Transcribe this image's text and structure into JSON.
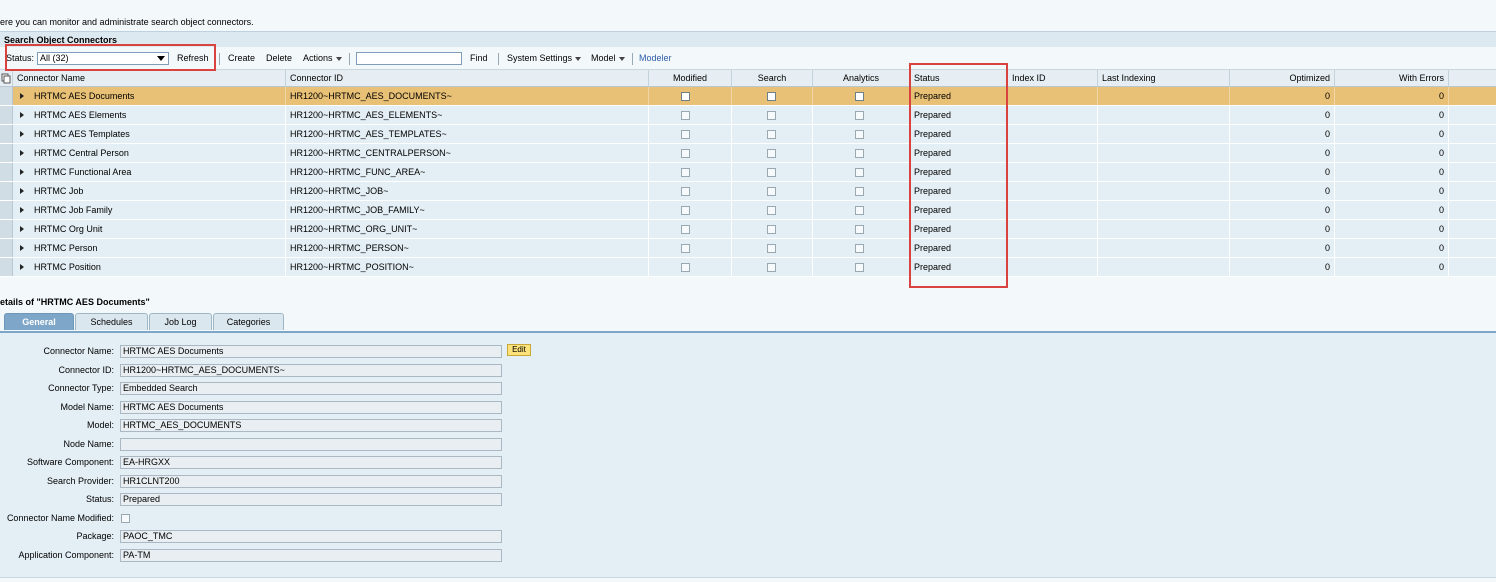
{
  "intro_text": "ere you can monitor and administrate search object connectors.",
  "panel_title": "Search Object Connectors",
  "toolbar": {
    "status_label": "Status:",
    "status_value": "All (32)",
    "refresh": "Refresh",
    "create": "Create",
    "delete": "Delete",
    "actions": "Actions",
    "find": "Find",
    "system_settings": "System Settings",
    "model": "Model",
    "modeler": "Modeler"
  },
  "columns": {
    "connector_name": "Connector Name",
    "connector_id": "Connector ID",
    "modified": "Modified",
    "search": "Search",
    "analytics": "Analytics",
    "status": "Status",
    "index_id": "Index ID",
    "last_indexing": "Last Indexing",
    "optimized": "Optimized",
    "with_errors": "With Errors"
  },
  "rows": [
    {
      "name": "HRTMC AES Documents",
      "id": "HR1200~HRTMC_AES_DOCUMENTS~",
      "status": "Prepared",
      "optimized": "0",
      "errors": "0"
    },
    {
      "name": "HRTMC AES Elements",
      "id": "HR1200~HRTMC_AES_ELEMENTS~",
      "status": "Prepared",
      "optimized": "0",
      "errors": "0"
    },
    {
      "name": "HRTMC AES Templates",
      "id": "HR1200~HRTMC_AES_TEMPLATES~",
      "status": "Prepared",
      "optimized": "0",
      "errors": "0"
    },
    {
      "name": "HRTMC Central Person",
      "id": "HR1200~HRTMC_CENTRALPERSON~",
      "status": "Prepared",
      "optimized": "0",
      "errors": "0"
    },
    {
      "name": "HRTMC Functional Area",
      "id": "HR1200~HRTMC_FUNC_AREA~",
      "status": "Prepared",
      "optimized": "0",
      "errors": "0"
    },
    {
      "name": "HRTMC Job",
      "id": "HR1200~HRTMC_JOB~",
      "status": "Prepared",
      "optimized": "0",
      "errors": "0"
    },
    {
      "name": "HRTMC Job Family",
      "id": "HR1200~HRTMC_JOB_FAMILY~",
      "status": "Prepared",
      "optimized": "0",
      "errors": "0"
    },
    {
      "name": "HRTMC Org Unit",
      "id": "HR1200~HRTMC_ORG_UNIT~",
      "status": "Prepared",
      "optimized": "0",
      "errors": "0"
    },
    {
      "name": "HRTMC Person",
      "id": "HR1200~HRTMC_PERSON~",
      "status": "Prepared",
      "optimized": "0",
      "errors": "0"
    },
    {
      "name": "HRTMC Position",
      "id": "HR1200~HRTMC_POSITION~",
      "status": "Prepared",
      "optimized": "0",
      "errors": "0"
    }
  ],
  "details": {
    "title": "etails of \"HRTMC AES Documents\"",
    "tabs": [
      "General",
      "Schedules",
      "Job Log",
      "Categories"
    ],
    "edit": "Edit",
    "fields": [
      {
        "label": "Connector Name:",
        "value": "HRTMC AES Documents"
      },
      {
        "label": "Connector ID:",
        "value": "HR1200~HRTMC_AES_DOCUMENTS~"
      },
      {
        "label": "Connector Type:",
        "value": "Embedded Search"
      },
      {
        "label": "Model Name:",
        "value": "HRTMC AES Documents"
      },
      {
        "label": "Model:",
        "value": "HRTMC_AES_DOCUMENTS"
      },
      {
        "label": "Node Name:",
        "value": ""
      },
      {
        "label": "Software Component:",
        "value": "EA-HRGXX"
      },
      {
        "label": "Search Provider:",
        "value": "HR1CLNT200"
      },
      {
        "label": "Status:",
        "value": "Prepared"
      },
      {
        "label": "Connector Name Modified:",
        "value": ""
      },
      {
        "label": "Package:",
        "value": "PAOC_TMC"
      },
      {
        "label": "Application Component:",
        "value": "PA-TM"
      }
    ]
  },
  "colors": {
    "selected_row": "#e9c176",
    "highlight_box": "#d9423e",
    "active_tab": "#7ea6c8"
  }
}
